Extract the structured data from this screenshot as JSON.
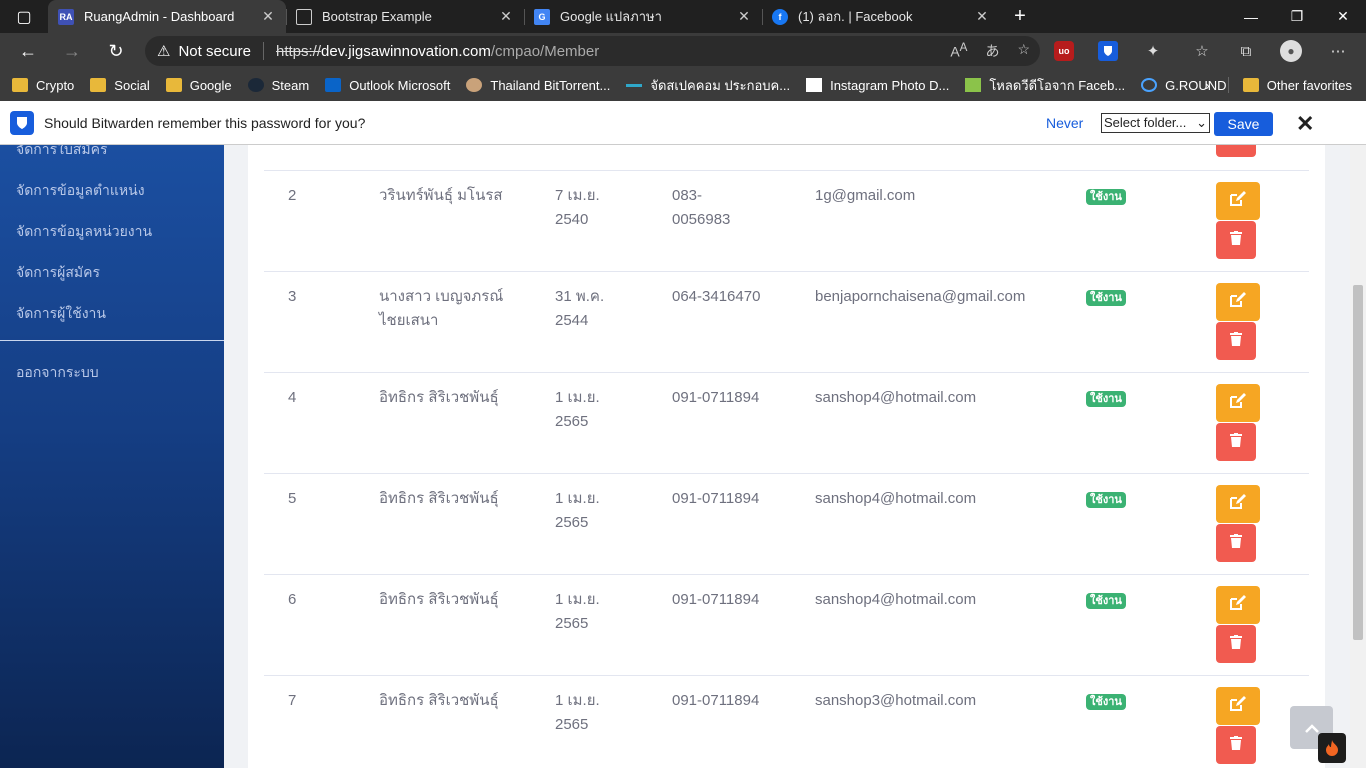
{
  "browser": {
    "tabs": [
      {
        "title": "RuangAdmin - Dashboard",
        "favicon": "RA",
        "active": true
      },
      {
        "title": "Bootstrap Example",
        "favicon": "page-icon",
        "active": false
      },
      {
        "title": "Google แปลภาษา",
        "favicon": "google-translate-icon",
        "active": false
      },
      {
        "title": "(1) ลอก. | Facebook",
        "favicon": "facebook-icon",
        "active": false
      }
    ],
    "address": {
      "security_label": "Not secure",
      "scheme": "https://",
      "host": "dev.jigsawinnovation.com",
      "path": "/cmpao/Member"
    },
    "bookmarks": [
      "Crypto",
      "Social",
      "Google",
      "Steam",
      "Outlook Microsoft",
      "Thailand BitTorrent...",
      "จัดสเปคคอม ประกอบค...",
      "Instagram Photo D...",
      "โหลดวีดีโอจาก Faceb...",
      "G.ROUND"
    ],
    "other_favorites": "Other favorites"
  },
  "bitwarden": {
    "prompt": "Should Bitwarden remember this password for you?",
    "never_label": "Never",
    "folder_select": "Select folder...",
    "save_label": "Save"
  },
  "sidebar": {
    "items": [
      "จัดการใบสมัคร",
      "จัดการข้อมูลตำแหน่ง",
      "จัดการข้อมูลหน่วยงาน",
      "จัดการผู้สมัคร",
      "จัดการผู้ใช้งาน"
    ],
    "logout_label": "ออกจากระบบ"
  },
  "members": {
    "rows": [
      {
        "no": "2",
        "name": [
          "วรินทร์พันธุ์ มโนรส"
        ],
        "birth": [
          "7 เม.ย.",
          "2540"
        ],
        "phone": [
          "083-",
          "0056983"
        ],
        "email": "1g@gmail.com",
        "status": "ใช้งาน"
      },
      {
        "no": "3",
        "name": [
          "นางสาว เบญจภรณ์",
          "ไชยเสนา"
        ],
        "birth": [
          "31 พ.ค.",
          "2544"
        ],
        "phone": [
          "064-3416470"
        ],
        "email": "benjapornchaisena@gmail.com",
        "status": "ใช้งาน"
      },
      {
        "no": "4",
        "name": [
          "อิทธิกร สิริเวชพันธุ์"
        ],
        "birth": [
          "1 เม.ย.",
          "2565"
        ],
        "phone": [
          "091-0711894"
        ],
        "email": "sanshop4@hotmail.com",
        "status": "ใช้งาน"
      },
      {
        "no": "5",
        "name": [
          "อิทธิกร สิริเวชพันธุ์"
        ],
        "birth": [
          "1 เม.ย.",
          "2565"
        ],
        "phone": [
          "091-0711894"
        ],
        "email": "sanshop4@hotmail.com",
        "status": "ใช้งาน"
      },
      {
        "no": "6",
        "name": [
          "อิทธิกร สิริเวชพันธุ์"
        ],
        "birth": [
          "1 เม.ย.",
          "2565"
        ],
        "phone": [
          "091-0711894"
        ],
        "email": "sanshop4@hotmail.com",
        "status": "ใช้งาน"
      },
      {
        "no": "7",
        "name": [
          "อิทธิกร สิริเวชพันธุ์"
        ],
        "birth": [
          "1 เม.ย.",
          "2565"
        ],
        "phone": [
          "091-0711894"
        ],
        "email": "sanshop3@hotmail.com",
        "status": "ใช้งาน"
      }
    ]
  },
  "colors": {
    "edit_button": "#f6a623",
    "delete_button": "#f15b50",
    "status_badge": "#3bb273",
    "sidebar": "#1b4fa1",
    "bitwarden_brand": "#175ddc"
  }
}
